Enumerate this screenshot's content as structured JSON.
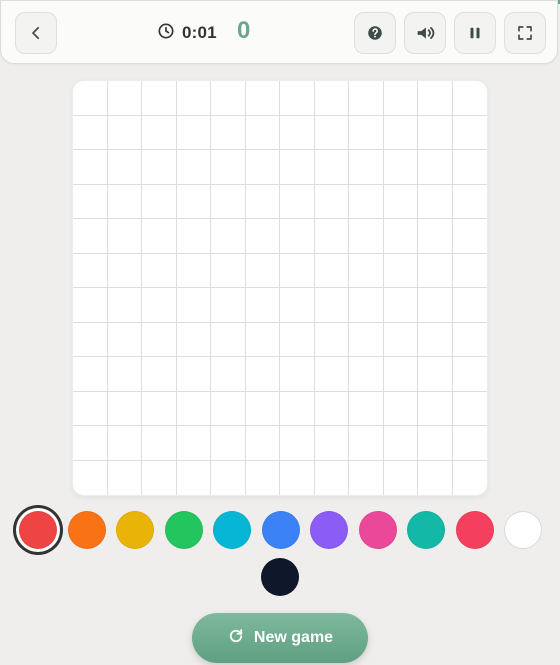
{
  "header": {
    "timer": "0:01",
    "score": "0",
    "icons": {
      "back": "chevron-left-icon",
      "clock": "clock-icon",
      "help": "help-icon",
      "sound": "volume-icon",
      "pause": "pause-icon",
      "fullscreen": "fullscreen-icon"
    }
  },
  "board": {
    "rows": 12,
    "columns": 12,
    "cell_color": "#ffffff",
    "grid_line_color": "#dedede"
  },
  "palette": {
    "colors": [
      "#ef4444",
      "#f97316",
      "#eab308",
      "#22c55e",
      "#06b6d4",
      "#3b82f6",
      "#8b5cf6",
      "#ec4899",
      "#14b8a6",
      "#f43f5e",
      "#ffffff",
      "#0f172a"
    ],
    "selected_index": 0
  },
  "actions": {
    "new_game_label": "New game"
  },
  "theme": {
    "accent": "#6aa88b",
    "background": "#efeeec"
  }
}
